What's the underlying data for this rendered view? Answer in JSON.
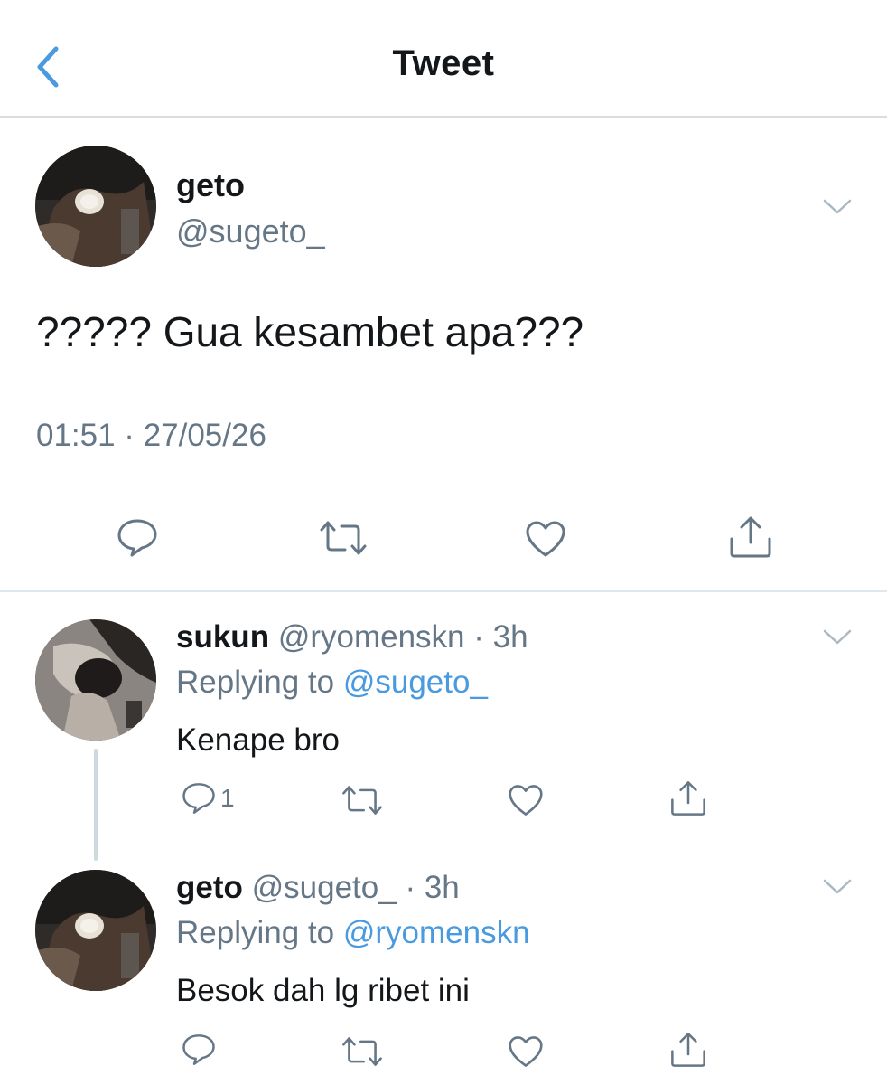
{
  "header": {
    "title": "Tweet",
    "back_icon": "chevron-left-icon",
    "accent_color": "#4a9ae0"
  },
  "main_tweet": {
    "name": "geto",
    "handle": "@sugeto_",
    "text": "????? Gua kesambet apa???",
    "timestamp": "01:51 · 27/05/26",
    "actions": [
      "reply-icon",
      "retweet-icon",
      "like-icon",
      "share-icon"
    ]
  },
  "replies": [
    {
      "name": "sukun",
      "handle": "@ryomenskn",
      "sep": "·",
      "time": "3h",
      "replying_prefix": "Replying to",
      "replying_to": "@sugeto_",
      "text": "Kenape bro",
      "reply_count": "1"
    },
    {
      "name": "geto",
      "handle": "@sugeto_",
      "sep": "·",
      "time": "3h",
      "replying_prefix": "Replying to",
      "replying_to": "@ryomenskn",
      "text": "Besok dah lg ribet ini",
      "reply_count": ""
    }
  ],
  "colors": {
    "text_primary": "#14171a",
    "text_secondary": "#657786",
    "icon_gray": "#657786",
    "divider": "#e1e8ed"
  }
}
